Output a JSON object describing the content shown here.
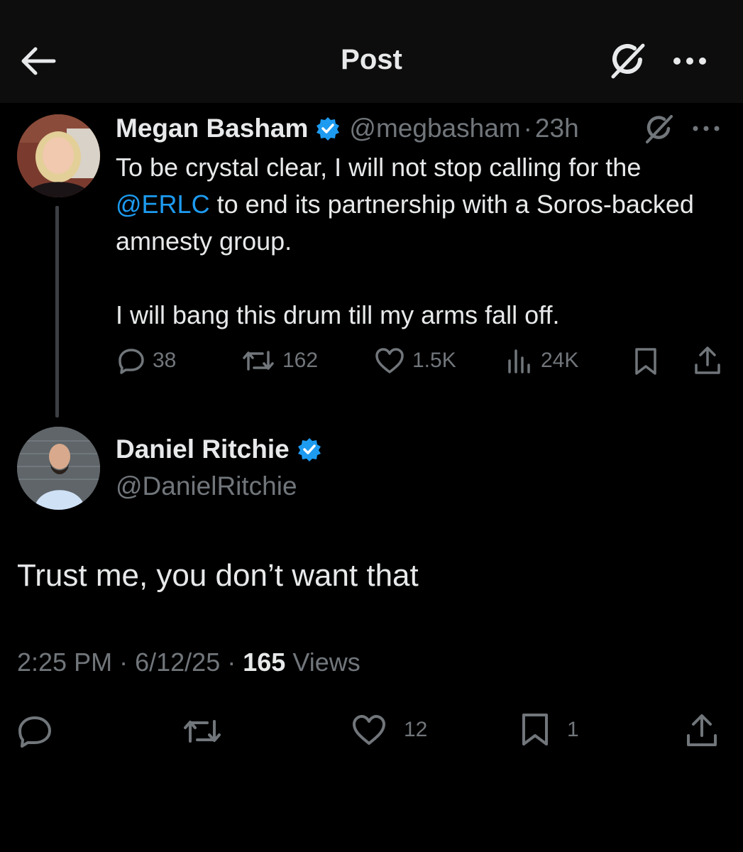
{
  "header": {
    "title": "Post",
    "back_icon": "arrow-left-icon",
    "grok_icon": "grok-icon",
    "more_icon": "more-horizontal-icon"
  },
  "colors": {
    "background": "#000000",
    "header_bg": "#0d0d0d",
    "text": "#e7e9ea",
    "muted": "#71767b",
    "link": "#1d9bf0",
    "verified": "#1d9bf0"
  },
  "original_post": {
    "author_name": "Megan Basham",
    "handle": "@megbasham",
    "separator": "·",
    "time": "23h",
    "text_part1": "To be crystal clear, I will not stop calling for the ",
    "mention": "@ERLC",
    "text_part2": " to end its partnership with a Soros-backed amnesty group.",
    "text_paragraph2": "I will bang this drum till my arms fall off.",
    "stats": {
      "replies": "38",
      "reposts": "162",
      "likes": "1.5K",
      "views": "24K"
    }
  },
  "reply_post": {
    "author_name": "Daniel Ritchie",
    "handle": "@DanielRitchie",
    "text": "Trust me, you don’t want that",
    "time": "2:25 PM",
    "date": "6/12/25",
    "separator": "·",
    "views_count": "165",
    "views_label": "Views",
    "stats": {
      "likes": "12",
      "bookmarks": "1"
    }
  }
}
